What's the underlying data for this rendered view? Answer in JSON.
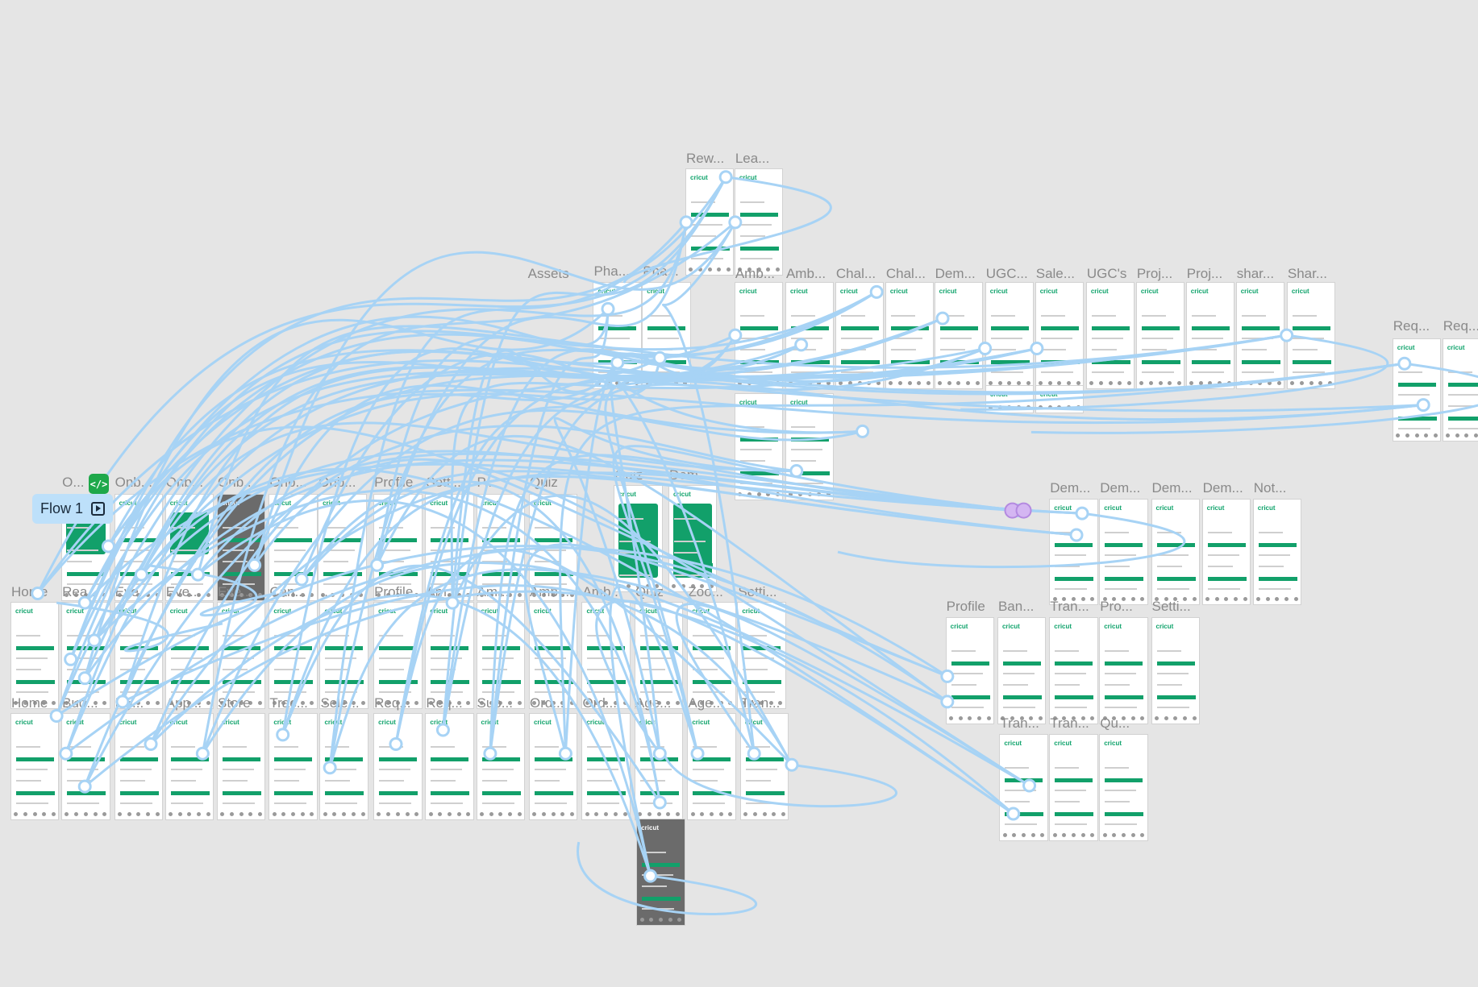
{
  "canvas": {
    "flow_label": "Flow 1",
    "code_chip_glyph": "</>",
    "start_icon": "play-icon",
    "connector_color": "#a7d3f5",
    "accent_color": "#12a06a",
    "brand_text": "cricut",
    "labels": [
      "Rew...",
      "Lea...",
      "Assets",
      "Pha...",
      "Pha...",
      "Amb...",
      "Amb...",
      "Chal...",
      "Chal...",
      "Dem...",
      "UGC...",
      "Sale...",
      "UGC's",
      "Proj...",
      "Proj...",
      "shar...",
      "Shar...",
      "Req...",
      "Req...",
      "O...",
      "Onb...",
      "Onb...",
      "Onb...",
      "Onb...",
      "Onb...",
      "Profile",
      "Setti...",
      "P...",
      "Quiz",
      "Quiz",
      "Dem...",
      "Dem...",
      "Dem...",
      "Dem...",
      "Dem...",
      "Not...",
      "Home",
      "Rea...",
      "Eve...",
      "Eve...",
      "Eve...",
      "Can...",
      "...",
      "Profile",
      "Am...",
      "Am...",
      "Amb...",
      "Amb...",
      "Quiz",
      "Zoo...",
      "Setti...",
      "Profile",
      "Ban...",
      "Tran...",
      "Pro...",
      "Setti...",
      "Home",
      "Bud...",
      "My...",
      "App...",
      "Store",
      "Trac...",
      "Sele...",
      "Req...",
      "Req...",
      "Sup...",
      "Ord...",
      "Ord...",
      "Age...",
      "Age...",
      "Tran...",
      "Tran...",
      "Tran...",
      "Qu..."
    ]
  }
}
